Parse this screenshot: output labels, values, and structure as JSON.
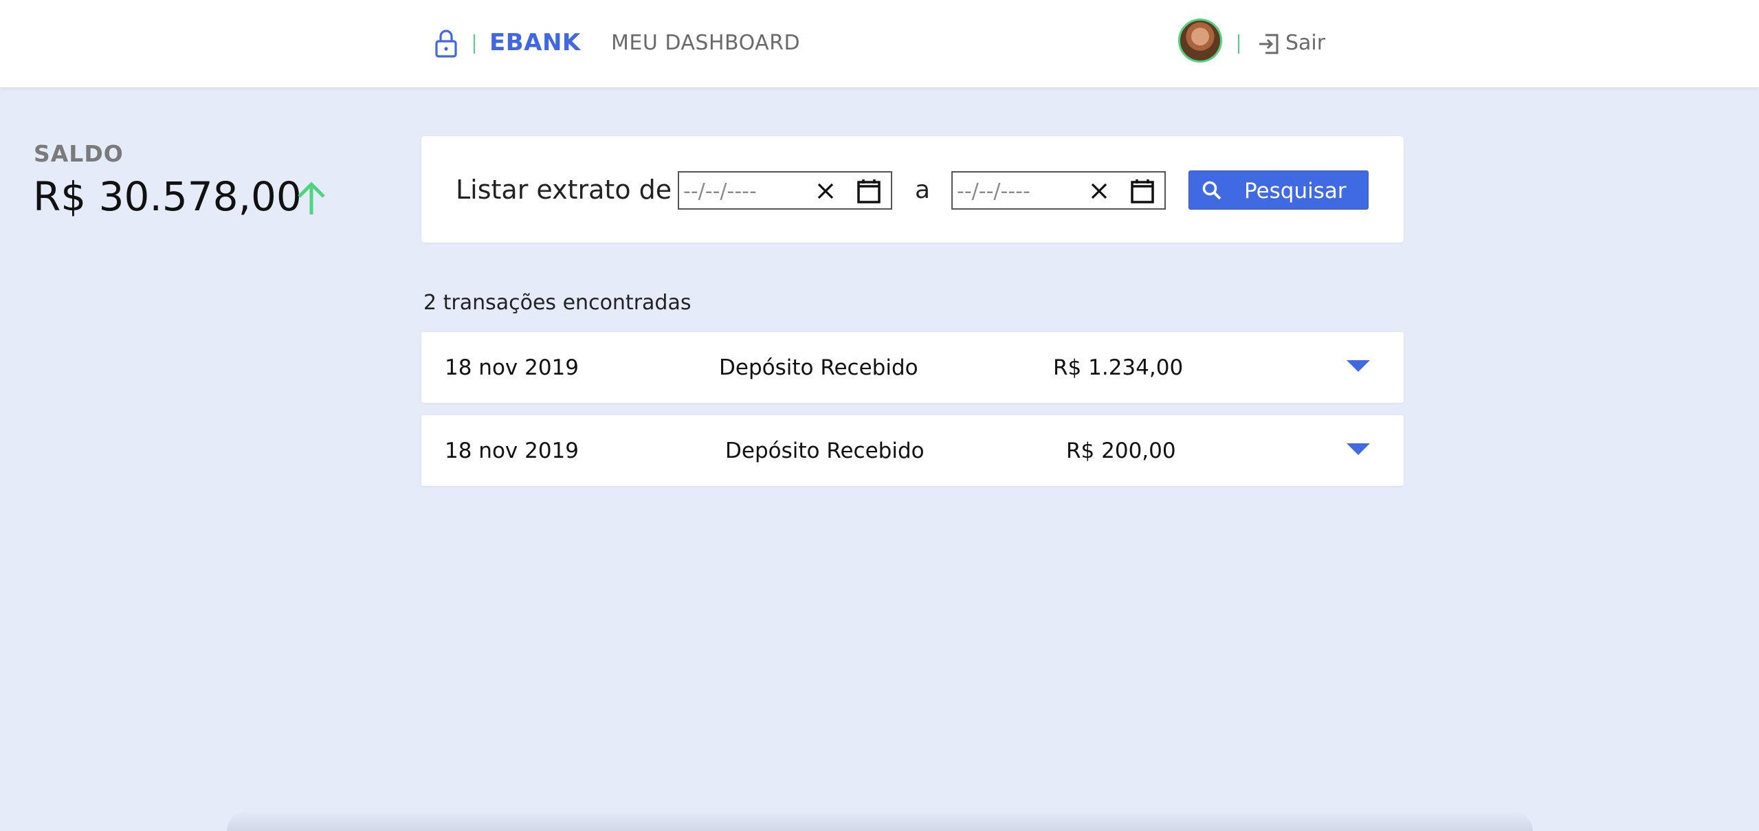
{
  "header": {
    "brand": "EBANK",
    "nav_dashboard": "MEU DASHBOARD",
    "logout_label": "Sair",
    "icons": {
      "lock": "lock-icon",
      "logout": "logout-icon"
    }
  },
  "balance": {
    "label": "SALDO",
    "value": "R$ 30.578,00",
    "trend_icon": "arrow-up-icon",
    "trend_color": "#4ed37f"
  },
  "filter": {
    "label": "Listar extrato de",
    "from_placeholder": "--/--/----",
    "separator": "a",
    "to_placeholder": "--/--/----",
    "search_label": "Pesquisar"
  },
  "results": {
    "count_text": "2 transações encontradas",
    "transactions": [
      {
        "date": "18 nov 2019",
        "description": "Depósito Recebido",
        "amount": "R$ 1.234,00"
      },
      {
        "date": "18 nov 2019",
        "description": "Depósito Recebido",
        "amount": "R$ 200,00"
      }
    ]
  },
  "colors": {
    "accent": "#3f6ae2",
    "brand": "#4168e0",
    "positive": "#4ed37f",
    "background": "#e6ebf9"
  }
}
